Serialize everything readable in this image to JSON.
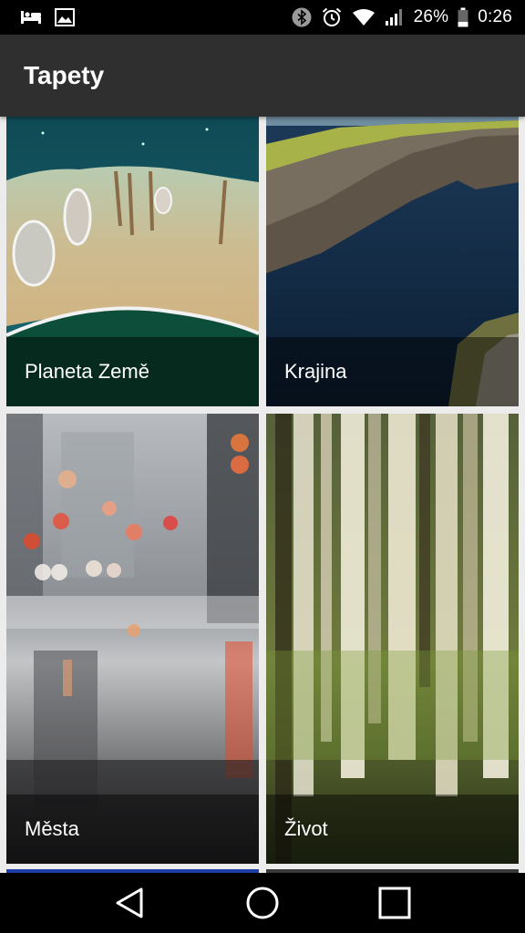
{
  "status_bar": {
    "left_icons": [
      "bed-icon",
      "image-icon"
    ],
    "right_icons": [
      "bluetooth-icon",
      "alarm-icon",
      "wifi-icon",
      "signal-icon",
      "battery-icon"
    ],
    "battery_percent": "26%",
    "time": "0:26"
  },
  "toolbar": {
    "title": "Tapety"
  },
  "categories": [
    {
      "label": "Planeta Země"
    },
    {
      "label": "Krajina"
    },
    {
      "label": "Města"
    },
    {
      "label": "Život"
    }
  ],
  "nav_bar": {
    "buttons": [
      "back-icon",
      "home-icon",
      "recents-icon"
    ]
  }
}
